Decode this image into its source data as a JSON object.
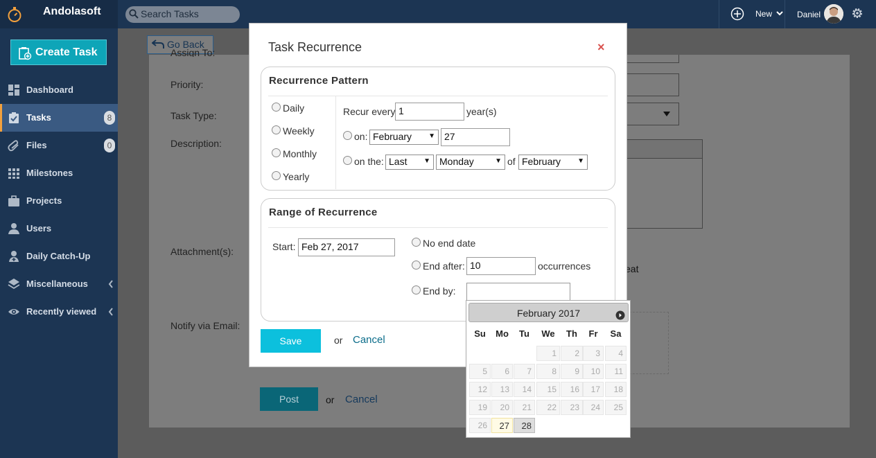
{
  "app": {
    "brand": "Andolasoft"
  },
  "topbar": {
    "search_placeholder": "Search Tasks",
    "new_label": "New",
    "user_name": "Daniel"
  },
  "sidebar": {
    "create_task_label": "Create Task",
    "items": [
      {
        "label": "Dashboard",
        "icon": "dashboard-icon"
      },
      {
        "label": "Tasks",
        "icon": "tasks-icon",
        "badge": "8",
        "active": true
      },
      {
        "label": "Files",
        "icon": "paperclip-icon",
        "badge": "0"
      },
      {
        "label": "Milestones",
        "icon": "grid-icon"
      },
      {
        "label": "Projects",
        "icon": "briefcase-icon"
      },
      {
        "label": "Users",
        "icon": "user-icon"
      },
      {
        "label": "Daily Catch-Up",
        "icon": "user-plus-icon"
      },
      {
        "label": "Miscellaneous",
        "icon": "layers-icon",
        "expandable": true
      },
      {
        "label": "Recently viewed",
        "icon": "eye-icon",
        "expandable": true
      }
    ]
  },
  "background_form": {
    "go_back_label": "Go Back",
    "assign_to_label": "Assign To:",
    "priority_label": "Priority:",
    "task_type_label": "Task Type:",
    "description_label": "Description:",
    "attachments_label": "Attachment(s):",
    "notify_label": "Notify via Email:",
    "repeat_partial": "eat",
    "post_label": "Post",
    "or_label": "or",
    "cancel_label": "Cancel"
  },
  "modal": {
    "title": "Task Recurrence",
    "close_symbol": "×",
    "pattern": {
      "title": "Recurrence Pattern",
      "options": [
        "Daily",
        "Weekly",
        "Monthly",
        "Yearly"
      ],
      "recur_every_label": "Recur every",
      "recur_every_value": "1",
      "recur_unit": "year(s)",
      "on_label": "on:",
      "on_month": "February",
      "on_day": "27",
      "on_the_label": "on the:",
      "on_the_ordinal": "Last",
      "on_the_weekday": "Monday",
      "of_label": "of",
      "on_the_month": "February"
    },
    "range": {
      "title": "Range of Recurrence",
      "start_label": "Start:",
      "start_value": "Feb 27, 2017",
      "no_end_label": "No end date",
      "end_after_label": "End after:",
      "end_after_value": "10",
      "occurrences_label": "occurrences",
      "end_by_label": "End by:",
      "end_by_value": ""
    },
    "save_label": "Save",
    "or_label": "or",
    "cancel_label": "Cancel"
  },
  "datepicker": {
    "month_title": "February 2017",
    "weekdays": [
      "Su",
      "Mo",
      "Tu",
      "We",
      "Th",
      "Fr",
      "Sa"
    ],
    "weeks": [
      [
        "",
        "",
        "",
        "1",
        "2",
        "3",
        "4"
      ],
      [
        "5",
        "6",
        "7",
        "8",
        "9",
        "10",
        "11"
      ],
      [
        "12",
        "13",
        "14",
        "15",
        "16",
        "17",
        "18"
      ],
      [
        "19",
        "20",
        "21",
        "22",
        "23",
        "24",
        "25"
      ],
      [
        "26",
        "27",
        "28",
        "",
        "",
        "",
        ""
      ]
    ],
    "today": "27",
    "selected": "28"
  },
  "colors": {
    "sidebar_bg": "#1c3553",
    "accent_teal": "#0cc0dd",
    "create_task_bg": "#0ea5b8",
    "close_red": "#d9534f"
  }
}
